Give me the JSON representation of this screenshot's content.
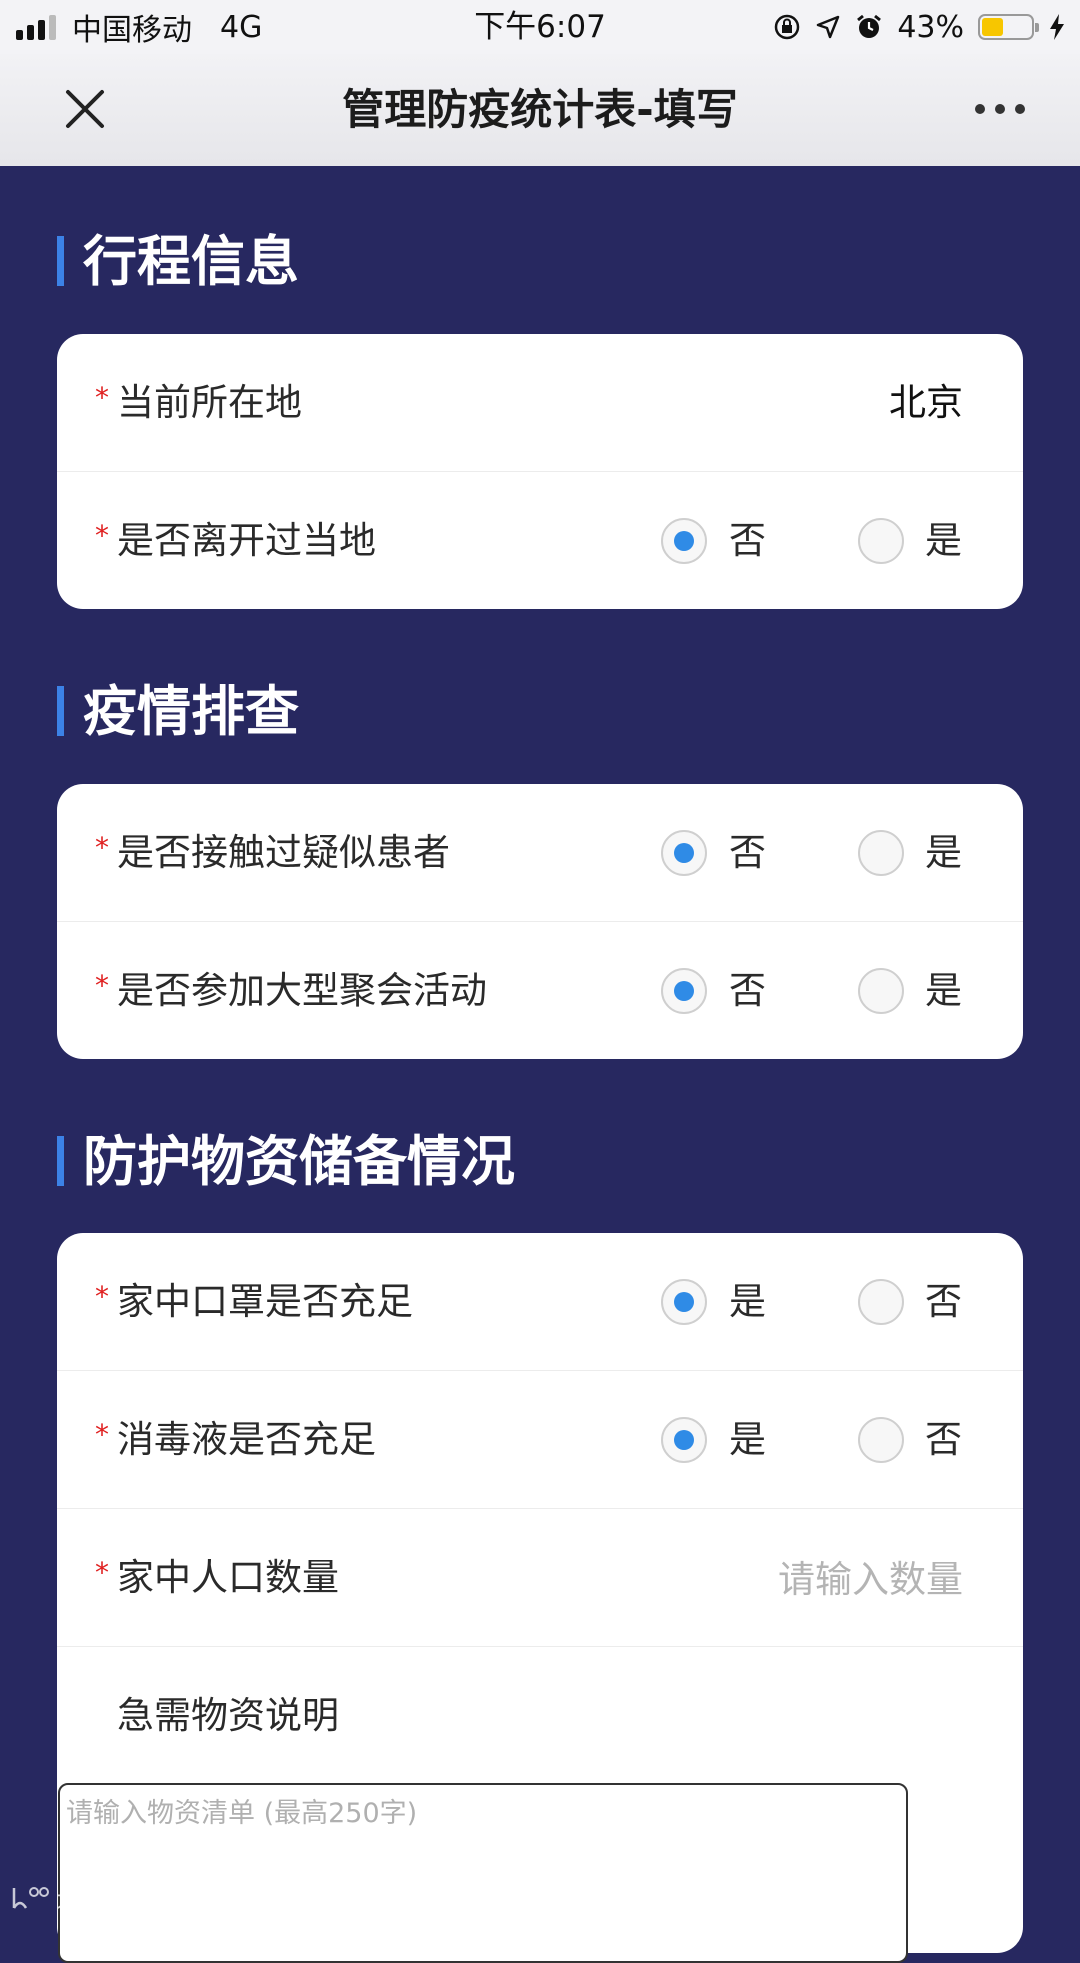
{
  "status_bar": {
    "carrier": "中国移动",
    "network": "4G",
    "time": "下午6:07",
    "battery_percent": "43%",
    "battery_level": 0.43,
    "icons": [
      "signal-icon",
      "orientation-lock-icon",
      "location-arrow-icon",
      "alarm-icon",
      "battery-icon",
      "charging-bolt-icon"
    ]
  },
  "nav": {
    "title": "管理防疫统计表-填写",
    "close_icon": "close-icon",
    "more_icon": "more-icon"
  },
  "sections": {
    "trip": {
      "title": "行程信息",
      "location_label": "当前所在地",
      "location_value": "北京",
      "left_local_label": "是否离开过当地",
      "left_local_opt1": "否",
      "left_local_opt2": "是"
    },
    "screening": {
      "title": "疫情排查",
      "contact_label": "是否接触过疑似患者",
      "contact_opt1": "否",
      "contact_opt2": "是",
      "gathering_label": "是否参加大型聚会活动",
      "gathering_opt1": "否",
      "gathering_opt2": "是"
    },
    "supplies": {
      "title": "防护物资储备情况",
      "masks_label": "家中口罩是否充足",
      "masks_opt1": "是",
      "masks_opt2": "否",
      "disinfectant_label": "消毒液是否充足",
      "disinfectant_opt1": "是",
      "disinfectant_opt2": "否",
      "household_label": "家中人口数量",
      "household_placeholder": "请输入数量",
      "urgent_label": "急需物资说明",
      "urgent_placeholder": "请输入物资清单 (最高250字)"
    }
  },
  "required_mark": "*",
  "watermark": "大数跨境",
  "colors": {
    "background": "#272860",
    "accent": "#3c82e6",
    "radio_checked": "#2f8be6",
    "required": "#e02020"
  }
}
